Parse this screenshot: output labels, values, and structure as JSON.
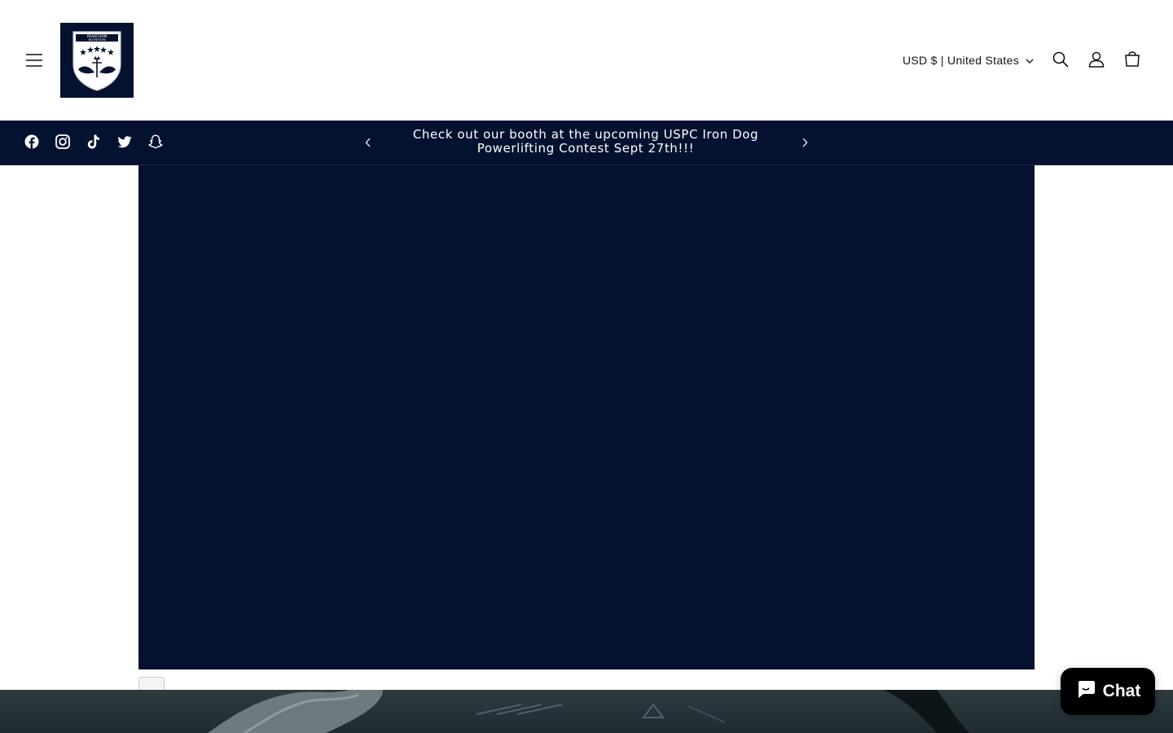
{
  "header": {
    "menu_icon": "hamburger-menu-icon",
    "logo_alt": "PEAKFORM NUTRITION",
    "locale_label": "USD $ | United States",
    "icons": [
      "search-icon",
      "account-icon",
      "cart-icon"
    ]
  },
  "announcement": {
    "text_line1": "Check out our booth at the upcoming USPC Iron Dog",
    "text_line2": "Powerlifting Contest Sept 27th!!!",
    "social_icons": [
      "facebook-icon",
      "instagram-icon",
      "tiktok-icon",
      "twitter-icon",
      "snapchat-icon"
    ]
  },
  "chat": {
    "label": "Chat"
  },
  "colors": {
    "navy": "#04112f",
    "white": "#ffffff",
    "chat_bg": "#000000"
  }
}
